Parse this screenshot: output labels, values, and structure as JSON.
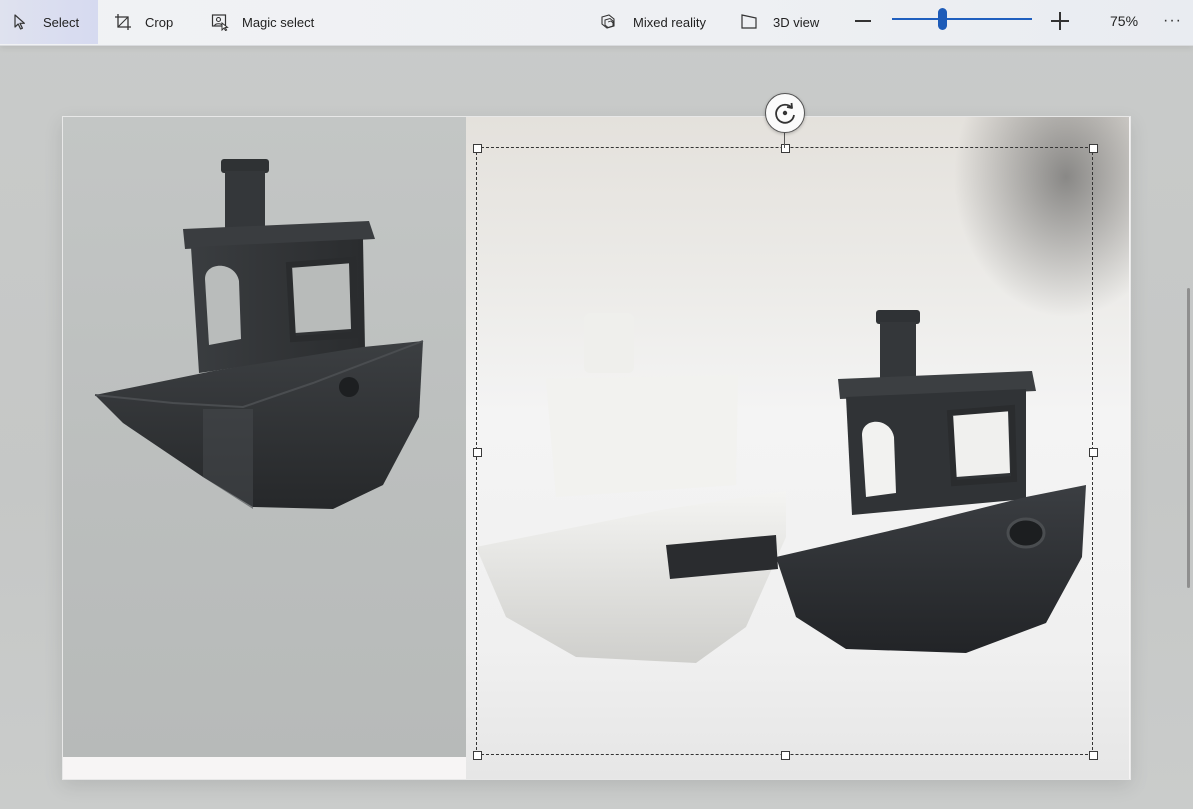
{
  "toolbar": {
    "select_label": "Select",
    "crop_label": "Crop",
    "magic_select_label": "Magic select",
    "mixed_reality_label": "Mixed reality",
    "view_3d_label": "3D view",
    "zoom_value": "75%",
    "zoom_level": 0.75,
    "more_label": "···"
  },
  "icons": {
    "select": "select-cursor-icon",
    "crop": "crop-icon",
    "magic_select": "magic-select-icon",
    "mixed_reality": "mixed-reality-icon",
    "view_3d": "3d-view-icon",
    "zoom_out": "minus-icon",
    "zoom_in": "plus-icon",
    "rotate": "rotate-icon"
  },
  "colors": {
    "accent": "#1f5fbf",
    "select_active_bg": "#d6daf0"
  }
}
